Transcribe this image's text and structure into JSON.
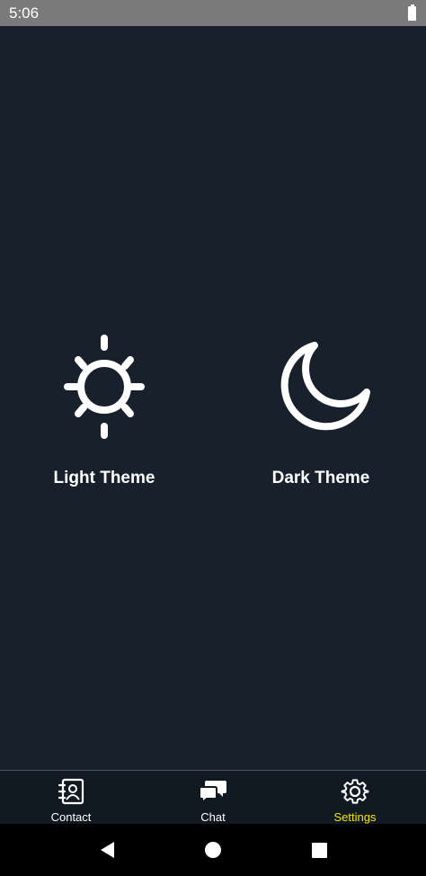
{
  "status_bar": {
    "time": "5:06",
    "battery_icon": "battery-full-icon"
  },
  "themes": {
    "light": {
      "label": "Light Theme",
      "icon": "sun-icon"
    },
    "dark": {
      "label": "Dark Theme",
      "icon": "moon-icon"
    }
  },
  "bottom_nav": {
    "items": [
      {
        "label": "Contact",
        "icon": "contact-book-icon"
      },
      {
        "label": "Chat",
        "icon": "chat-bubbles-icon"
      },
      {
        "label": "Settings",
        "icon": "gear-icon"
      }
    ],
    "active": "Settings",
    "active_color": "#f2e600"
  },
  "system_nav": {
    "buttons": [
      "back-icon",
      "home-icon",
      "recents-icon"
    ]
  },
  "colors": {
    "background": "#17202b",
    "status_bar": "#7a7a7a",
    "nav_background": "#111a23"
  }
}
